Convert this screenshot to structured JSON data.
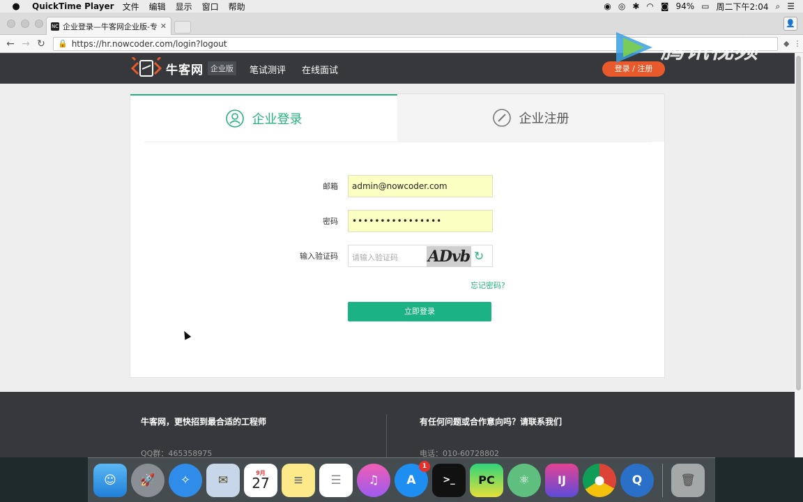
{
  "menubar": {
    "app": "QuickTime Player",
    "items": [
      "文件",
      "编辑",
      "显示",
      "窗口",
      "帮助"
    ],
    "battery": "94%",
    "clock": "周二下午2:04"
  },
  "browser": {
    "tab_title": "企业登录—牛客网企业版-专业IT",
    "url": "https://hr.nowcoder.com/login?logout"
  },
  "site": {
    "logo_name": "牛客网",
    "logo_badge": "企业版",
    "nav": [
      "笔试测评",
      "在线面试"
    ],
    "login_register": "登录 / 注册",
    "watermark": "腾讯视频"
  },
  "login": {
    "tab_login": "企业登录",
    "tab_register": "企业注册",
    "email_label": "邮箱",
    "email_value": "admin@nowcoder.com",
    "password_label": "密码",
    "password_value": "••••••••••••••••",
    "captcha_label": "输入验证码",
    "captcha_placeholder": "请输入验证码",
    "captcha_text": "ADvb",
    "forgot": "忘记密码?",
    "submit": "立即登录"
  },
  "footer": {
    "left_title": "牛客网，更快招到最合适的工程师",
    "left_info": "QQ群：465358975",
    "right_title": "有任何问题或合作意向吗？请联系我们",
    "right_info": "电话：010-60728802"
  },
  "dock": {
    "calendar_month": "9月",
    "calendar_day": "27",
    "appstore_badge": "1",
    "pycharm": "PC",
    "intellij": "IJ"
  },
  "colors": {
    "accent": "#25b27f",
    "header": "#36383b",
    "orange": "#e85a2c",
    "autofill": "#fbffc2"
  }
}
